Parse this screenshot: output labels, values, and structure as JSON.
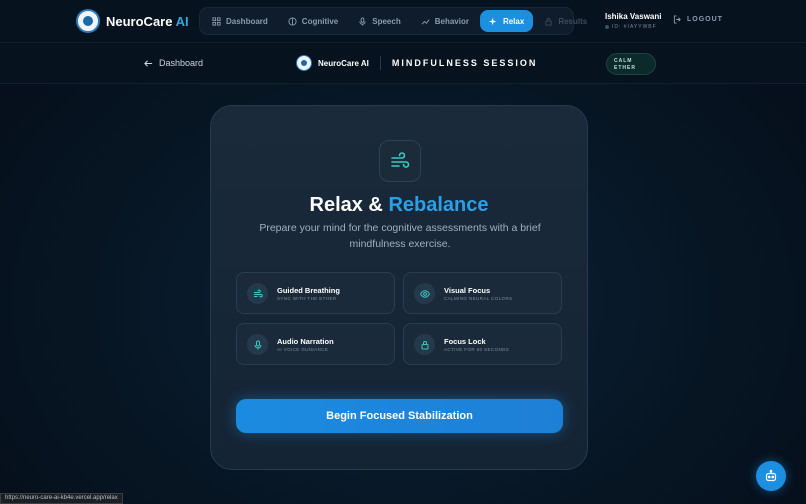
{
  "brand": {
    "name": "NeuroCare",
    "ai": "AI"
  },
  "nav": [
    {
      "label": "Dashboard",
      "state": "normal"
    },
    {
      "label": "Cognitive",
      "state": "normal"
    },
    {
      "label": "Speech",
      "state": "normal"
    },
    {
      "label": "Behavior",
      "state": "normal"
    },
    {
      "label": "Relax",
      "state": "active"
    },
    {
      "label": "Results",
      "state": "disabled"
    }
  ],
  "user": {
    "name": "Ishika Vaswani",
    "id": "ID: #IAYYWBF"
  },
  "logout_label": "LOGOUT",
  "subbar": {
    "back_label": "Dashboard",
    "brand_text": "NeuroCare AI",
    "session_title": "MINDFULNESS SESSION",
    "badge_line1": "CALM",
    "badge_line2": "ETHER"
  },
  "card": {
    "title_part1": "Relax &",
    "title_part2": "Rebalance",
    "description": "Prepare your mind for the cognitive assessments with a brief mindfulness exercise.",
    "features": [
      {
        "title": "Guided Breathing",
        "subtitle": "SYNC WITH THE ETHER",
        "icon": "wind-icon"
      },
      {
        "title": "Visual Focus",
        "subtitle": "CALMING NEURAL COLORS",
        "icon": "eye-icon"
      },
      {
        "title": "Audio Narration",
        "subtitle": "AI VOICE GUIDANCE",
        "icon": "microphone-icon"
      },
      {
        "title": "Focus Lock",
        "subtitle": "ACTIVE FOR 60 SECONDS",
        "icon": "lock-icon"
      }
    ],
    "button_label": "Begin Focused Stabilization"
  },
  "status_url": "https://neuro-care-ai-kb4e.vercel.app/relax",
  "colors": {
    "accent": "#1c8fe0",
    "teal": "#3fc7c0",
    "background": "#071523"
  }
}
